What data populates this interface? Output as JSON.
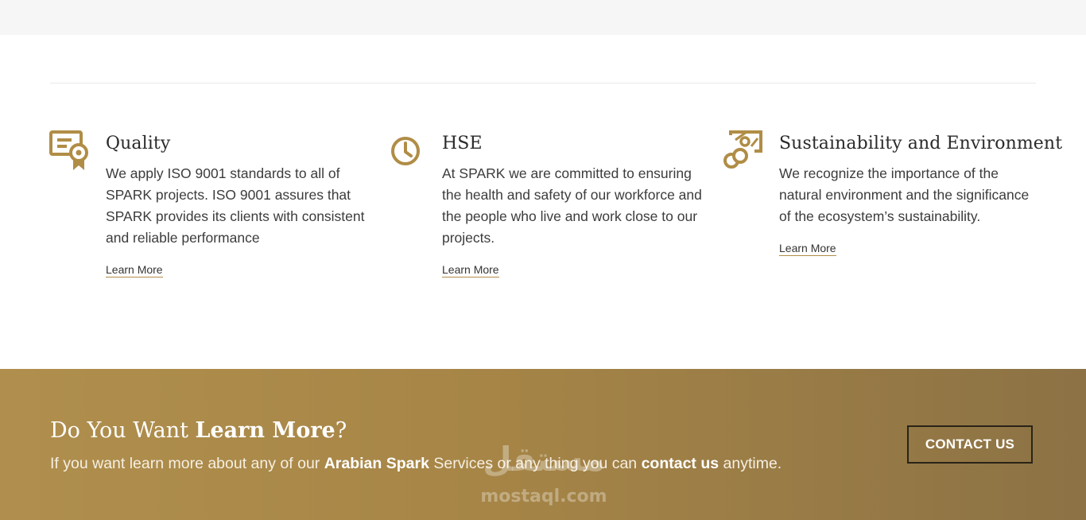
{
  "colors": {
    "accent": "#b08d46",
    "cta_start": "#b08f4e",
    "cta_end": "#8c7245"
  },
  "features": [
    {
      "icon": "certificate-icon",
      "title": "Quality",
      "description": "We apply ISO 9001 standards to all of SPARK projects. ISO 9001 assures that SPARK provides its clients with consistent and reliable performance",
      "link": "Learn More"
    },
    {
      "icon": "clock-icon",
      "title": "HSE",
      "description": "At SPARK we are committed to ensuring the health and safety of our workforce and the people who live and work close to our projects.",
      "link": "Learn More"
    },
    {
      "icon": "environment-icon",
      "title": "Sustainability and Environment",
      "description": "We recognize the importance of the natural environment and the significance of the ecosystem’s sustainability.",
      "link": "Learn More"
    }
  ],
  "cta": {
    "heading_plain": "Do You Want ",
    "heading_bold": "Learn More",
    "heading_end": "?",
    "sub_1": "If you want learn more about any of our ",
    "sub_bold_1": "Arabian Spark",
    "sub_2": " Services or any thing you can ",
    "sub_bold_2": "contact us",
    "sub_3": " anytime.",
    "button": "CONTACT US"
  },
  "watermark": {
    "arabic": "مستقل",
    "latin": "mostaql.com"
  }
}
